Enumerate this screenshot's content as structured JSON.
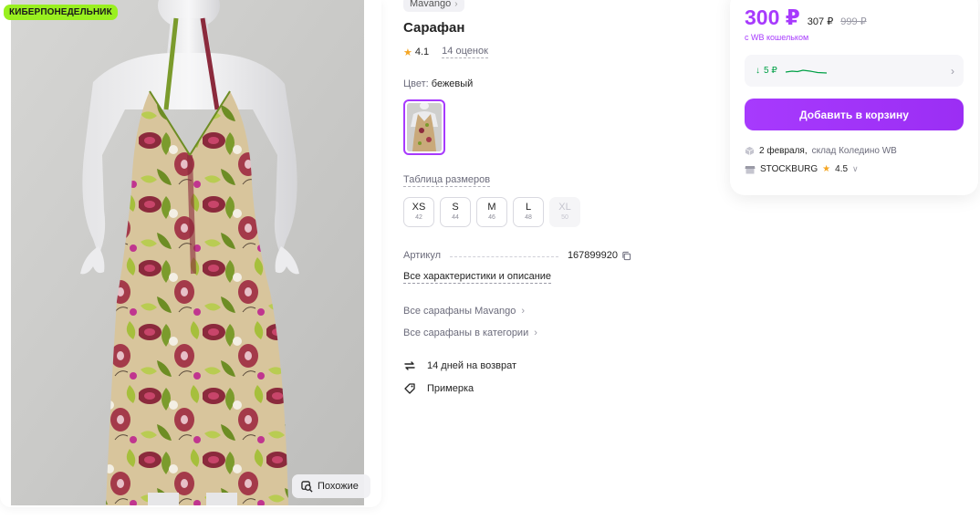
{
  "gallery": {
    "promo_badge": "КИБЕРПОНЕДЕЛЬНИК",
    "similar_label": "Похожие"
  },
  "product": {
    "brand": "Mavango",
    "title": "Сарафан",
    "rating": "4.1",
    "reviews": "14 оценок",
    "color_label": "Цвет:",
    "color_value": "бежевый",
    "size_table": "Таблица размеров",
    "sizes": [
      {
        "size": "XS",
        "num": "42",
        "available": true
      },
      {
        "size": "S",
        "num": "44",
        "available": true
      },
      {
        "size": "M",
        "num": "46",
        "available": true
      },
      {
        "size": "L",
        "num": "48",
        "available": true
      },
      {
        "size": "XL",
        "num": "50",
        "available": false
      }
    ],
    "article_label": "Артикул",
    "article_value": "167899920",
    "all_specs": "Все характеристики и описание",
    "links": [
      "Все сарафаны Mavango",
      "Все сарафаны в категории"
    ],
    "features": [
      "14 дней на возврат",
      "Примерка"
    ]
  },
  "price_card": {
    "price": "300 ₽",
    "old_price": "307 ₽",
    "crossed_price": "999 ₽",
    "wallet_note": "с WB кошельком",
    "history_label": "5 ₽",
    "cart_button": "Добавить в корзину",
    "delivery_date": "2 февраля,",
    "delivery_warehouse": "склад Коледино WB",
    "seller_name": "STOCKBURG",
    "seller_rating": "4.5"
  },
  "colors": {
    "accent": "#a73afd",
    "promo": "#99f01f",
    "star": "#f5a623",
    "history_green": "#00a046"
  }
}
